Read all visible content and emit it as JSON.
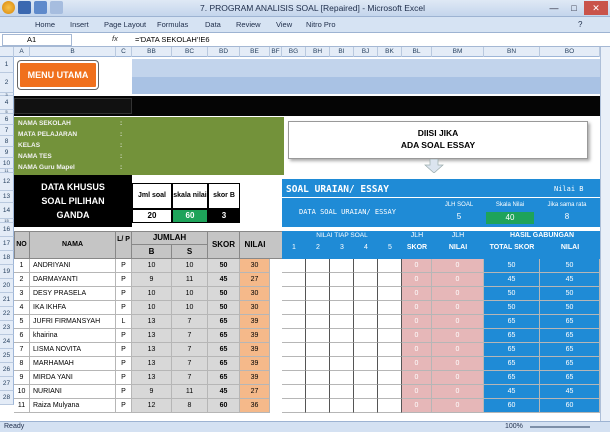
{
  "window": {
    "title": "7. PROGRAM ANALISIS SOAL [Repaired] - Microsoft Excel"
  },
  "menu": [
    "Home",
    "Insert",
    "Page Layout",
    "Formulas",
    "Data",
    "Review",
    "View",
    "Nitro Pro"
  ],
  "formula_bar": {
    "cell": "A1",
    "fx": "fx",
    "formula": "='DATA SEKOLAH'!E6"
  },
  "columns": [
    "A",
    "B",
    "C",
    "BB",
    "BC",
    "BD",
    "BE",
    "BF",
    "BG",
    "BH",
    "BI",
    "BJ",
    "BK",
    "BL",
    "BM",
    "BN",
    "BO"
  ],
  "rows": [
    "1",
    "2",
    "3",
    "4",
    "5",
    "6",
    "7",
    "8",
    "9",
    "10",
    "11",
    "12",
    "13",
    "14",
    "15",
    "16",
    "17",
    "18",
    "19",
    "20",
    "21",
    "22",
    "23",
    "24",
    "25",
    "26",
    "27",
    "28"
  ],
  "menu_button": "MENU UTAMA",
  "school_info": [
    "NAMA SEKOLAH",
    "MATA PELAJARAN",
    "KELAS",
    "NAMA TES",
    "NAMA Guru Mapel"
  ],
  "colon": ":",
  "callout": {
    "line1": "DIISI JIKA",
    "line2": "ADA SOAL ESSAY"
  },
  "pg": {
    "title1": "DATA KHUSUS",
    "title2": "SOAL PILIHAN",
    "title3": "GANDA",
    "jml_label": "Jml soal",
    "skala_label": "skala nilai",
    "skor_label": "skor B",
    "jml_val": "20",
    "skala_val": "60",
    "skor_val": "3"
  },
  "essay": {
    "title": "SOAL URAIAN/ ESSAY",
    "nilai_b": "Nilai B",
    "sub": "DATA SOAL URAIAN/ ESSAY",
    "jlh_soal": "JLH SOAL",
    "skala": "Skala Nilai",
    "jika": "Jika sama rata",
    "jlh_val": "5",
    "skala_val": "40",
    "jika_val": "8"
  },
  "table_headers": {
    "no": "NO",
    "nama": "NAMA",
    "lp": "L/ P",
    "jumlah": "JUMLAH",
    "b": "B",
    "s": "S",
    "skor": "SKOR",
    "nilai": "NILAI",
    "nilai_tiap": "NILAI TIAP SOAL",
    "n1": "1",
    "n2": "2",
    "n3": "3",
    "n4": "4",
    "n5": "5",
    "jlh": "JLH",
    "jlh_skor": "SKOR",
    "jlh2": "JLH",
    "jlh_nilai": "NILAI",
    "hasil": "HASIL GABUNGAN",
    "total": "TOTAL SKOR",
    "nilai2": "NILAI"
  },
  "students": [
    {
      "no": "1",
      "nama": "ANDRIYANI",
      "lp": "P",
      "b": "10",
      "s": "10",
      "skor": "50",
      "nilai": "30",
      "jskor": "0",
      "jnilai": "0",
      "total": "50",
      "nilai2": "50"
    },
    {
      "no": "2",
      "nama": "DARMAYANTI",
      "lp": "P",
      "b": "9",
      "s": "11",
      "skor": "45",
      "nilai": "27",
      "jskor": "0",
      "jnilai": "0",
      "total": "45",
      "nilai2": "45"
    },
    {
      "no": "3",
      "nama": "DESY PRASELA",
      "lp": "P",
      "b": "10",
      "s": "10",
      "skor": "50",
      "nilai": "30",
      "jskor": "0",
      "jnilai": "0",
      "total": "50",
      "nilai2": "50"
    },
    {
      "no": "4",
      "nama": "IKA IKHFA",
      "lp": "P",
      "b": "10",
      "s": "10",
      "skor": "50",
      "nilai": "30",
      "jskor": "0",
      "jnilai": "0",
      "total": "50",
      "nilai2": "50"
    },
    {
      "no": "5",
      "nama": "JUFRI FIRMANSYAH",
      "lp": "L",
      "b": "13",
      "s": "7",
      "skor": "65",
      "nilai": "39",
      "jskor": "0",
      "jnilai": "0",
      "total": "65",
      "nilai2": "65"
    },
    {
      "no": "6",
      "nama": "khairina",
      "lp": "P",
      "b": "13",
      "s": "7",
      "skor": "65",
      "nilai": "39",
      "jskor": "0",
      "jnilai": "0",
      "total": "65",
      "nilai2": "65"
    },
    {
      "no": "7",
      "nama": "LISMA NOVITA",
      "lp": "P",
      "b": "13",
      "s": "7",
      "skor": "65",
      "nilai": "39",
      "jskor": "0",
      "jnilai": "0",
      "total": "65",
      "nilai2": "65"
    },
    {
      "no": "8",
      "nama": "MARHAMAH",
      "lp": "P",
      "b": "13",
      "s": "7",
      "skor": "65",
      "nilai": "39",
      "jskor": "0",
      "jnilai": "0",
      "total": "65",
      "nilai2": "65"
    },
    {
      "no": "9",
      "nama": "MIRDA YANI",
      "lp": "P",
      "b": "13",
      "s": "7",
      "skor": "65",
      "nilai": "39",
      "jskor": "0",
      "jnilai": "0",
      "total": "65",
      "nilai2": "65"
    },
    {
      "no": "10",
      "nama": "NURIANI",
      "lp": "P",
      "b": "9",
      "s": "11",
      "skor": "45",
      "nilai": "27",
      "jskor": "0",
      "jnilai": "0",
      "total": "45",
      "nilai2": "45"
    },
    {
      "no": "11",
      "nama": "Raiza Mulyana",
      "lp": "P",
      "b": "12",
      "s": "8",
      "skor": "60",
      "nilai": "36",
      "jskor": "0",
      "jnilai": "0",
      "total": "60",
      "nilai2": "60"
    }
  ],
  "status": {
    "ready": "Ready",
    "zoom": "100%"
  },
  "colors": {
    "menu_orange": "#f0701c",
    "green_fill": "#73923a",
    "blue_fill": "#1f8bd6",
    "pink_fill": "#e6b7b8",
    "header_gray": "#c5c5c5"
  }
}
